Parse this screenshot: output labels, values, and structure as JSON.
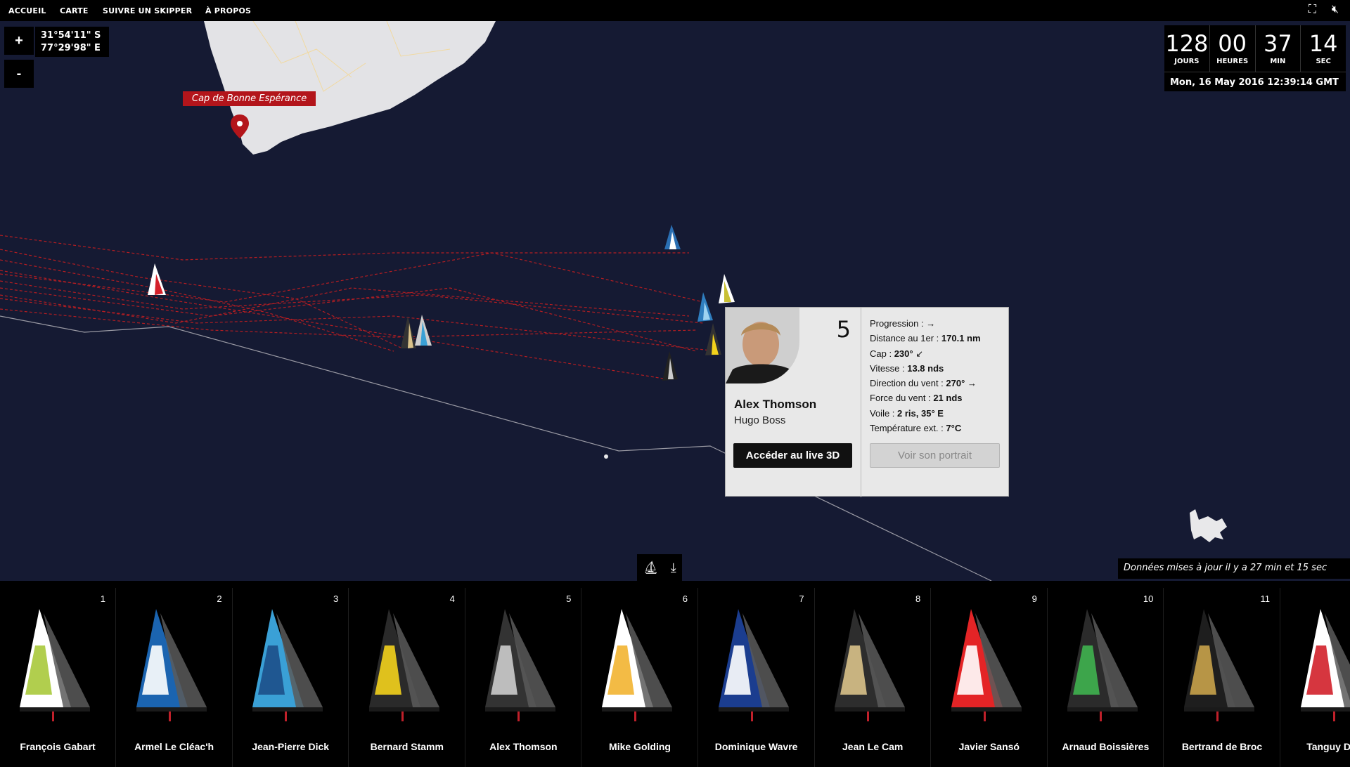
{
  "nav": {
    "items": [
      "ACCUEIL",
      "CARTE",
      "SUIVRE UN SKIPPER",
      "À PROPOS"
    ],
    "icons": [
      "fullscreen-icon",
      "mute-icon"
    ]
  },
  "map": {
    "zoom_in": "+",
    "zoom_out": "-",
    "coords": {
      "lat": "31°54'11\" S",
      "lon": "77°29'98\" E"
    },
    "cape_label": "Cap de Bonne Espérance",
    "updated_text": "Données mises à jour il y a 27 min et 15 sec"
  },
  "countdown": {
    "days": "128",
    "days_label": "JOURS",
    "hours": "00",
    "hours_label": "HEURES",
    "min": "37",
    "min_label": "MIN",
    "sec": "14",
    "sec_label": "SEC",
    "date": "Mon, 16 May 2016 12:39:14 GMT"
  },
  "popup": {
    "rank": "5",
    "name": "Alex Thomson",
    "boat": "Hugo Boss",
    "stats": [
      {
        "label": "Progression : ",
        "value": "",
        "arrow": "→"
      },
      {
        "label": "Distance au 1er : ",
        "value": "170.1 nm",
        "arrow": ""
      },
      {
        "label": "Cap : ",
        "value": "230°",
        "arrow": "↙"
      },
      {
        "label": "Vitesse : ",
        "value": "13.8 nds",
        "arrow": ""
      },
      {
        "label": "Direction du vent : ",
        "value": "270°",
        "arrow": "→"
      },
      {
        "label": "Force du vent : ",
        "value": "21 nds",
        "arrow": ""
      },
      {
        "label": "Voile : ",
        "value": "2 ris, 35° E",
        "arrow": ""
      },
      {
        "label": "Température ext. : ",
        "value": "7°C",
        "arrow": ""
      }
    ],
    "btn_live": "Accéder au live 3D",
    "btn_portrait": "Voir son portrait"
  },
  "skippers": [
    {
      "rank": "1",
      "name": "François Gabart",
      "color": "#ffffff",
      "accent": "#a8c93b"
    },
    {
      "rank": "2",
      "name": "Armel Le Cléac'h",
      "color": "#1b64b0",
      "accent": "#ffffff"
    },
    {
      "rank": "3",
      "name": "Jean-Pierre Dick",
      "color": "#3aa0d6",
      "accent": "#1d4f8a"
    },
    {
      "rank": "4",
      "name": "Bernard Stamm",
      "color": "#2a2a2a",
      "accent": "#f3d21c"
    },
    {
      "rank": "5",
      "name": "Alex Thomson",
      "color": "#333333",
      "accent": "#cccccc"
    },
    {
      "rank": "6",
      "name": "Mike Golding",
      "color": "#ffffff",
      "accent": "#f2b431"
    },
    {
      "rank": "7",
      "name": "Dominique Wavre",
      "color": "#1b3d8f",
      "accent": "#ffffff"
    },
    {
      "rank": "8",
      "name": "Jean Le Cam",
      "color": "#2d2d2d",
      "accent": "#d9c28a"
    },
    {
      "rank": "9",
      "name": "Javier Sansó",
      "color": "#e42426",
      "accent": "#ffffff"
    },
    {
      "rank": "10",
      "name": "Arnaud Boissières",
      "color": "#2b2b2b",
      "accent": "#3fb34f"
    },
    {
      "rank": "11",
      "name": "Bertrand de Broc",
      "color": "#1e1e1e",
      "accent": "#c8a24a"
    },
    {
      "rank": "",
      "name": "Tanguy De La",
      "color": "#ffffff",
      "accent": "#d1202a"
    }
  ]
}
